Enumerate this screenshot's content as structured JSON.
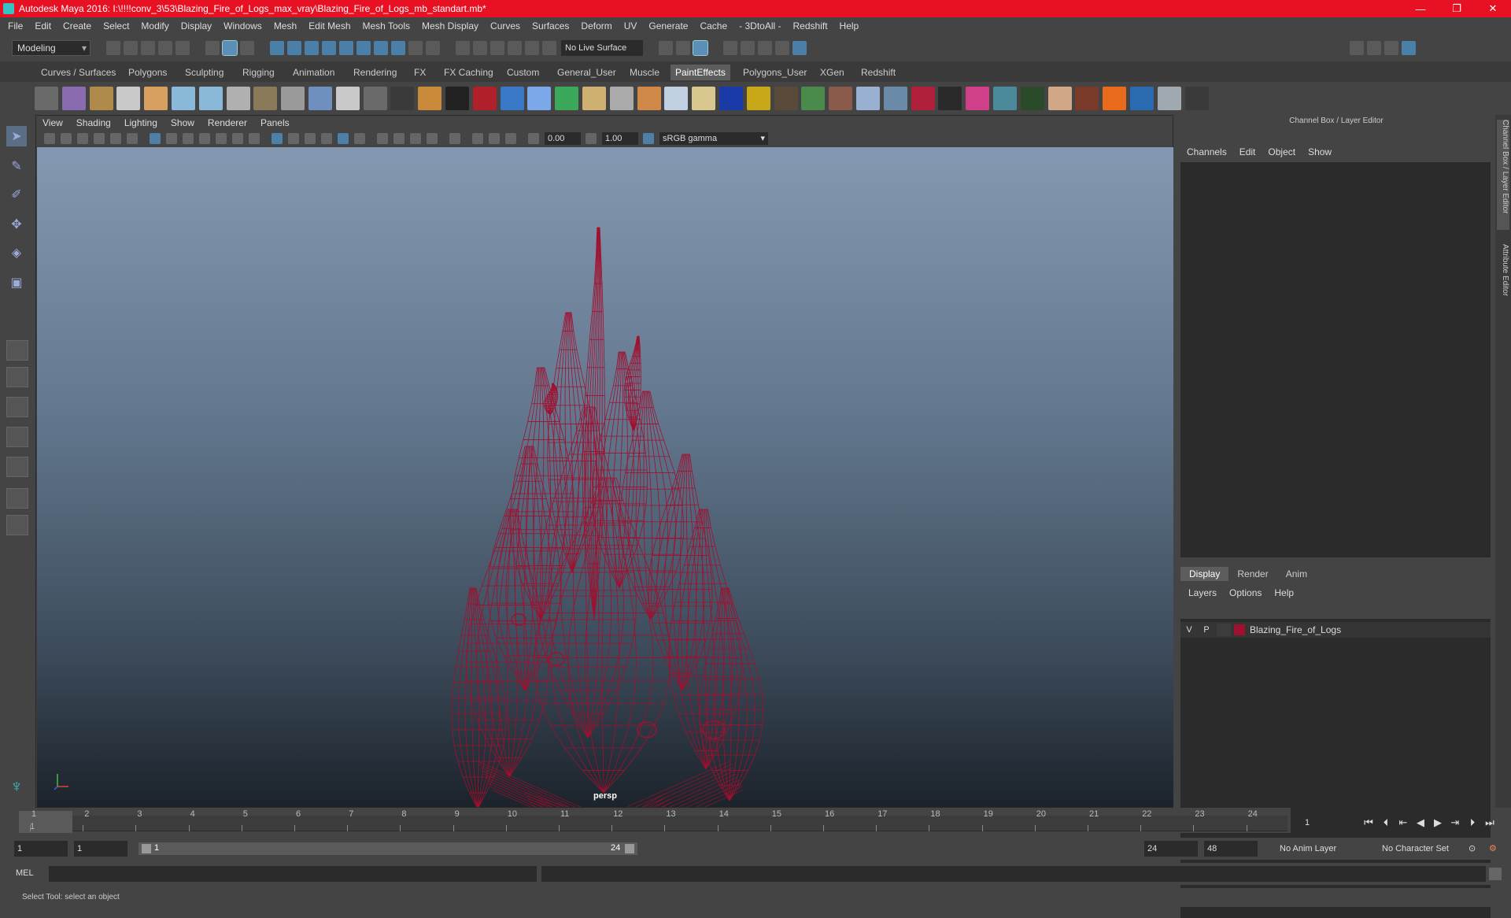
{
  "window": {
    "title": "Autodesk Maya 2016: I:\\!!!!conv_3\\53\\Blazing_Fire_of_Logs_max_vray\\Blazing_Fire_of_Logs_mb_standart.mb*",
    "minimize": "—",
    "maximize": "❐",
    "close": "✕"
  },
  "menubar": [
    "File",
    "Edit",
    "Create",
    "Select",
    "Modify",
    "Display",
    "Windows",
    "Mesh",
    "Edit Mesh",
    "Mesh Tools",
    "Mesh Display",
    "Curves",
    "Surfaces",
    "Deform",
    "UV",
    "Generate",
    "Cache",
    "- 3DtoAll -",
    "Redshift",
    "Help"
  ],
  "toolbar": {
    "mode": "Modeling",
    "live_surface": "No Live Surface"
  },
  "shelf": {
    "tabs": [
      "Curves / Surfaces",
      "Polygons",
      "Sculpting",
      "Rigging",
      "Animation",
      "Rendering",
      "FX",
      "FX Caching",
      "Custom",
      "General_User",
      "Muscle",
      "PaintEffects",
      "Polygons_User",
      "XGen",
      "Redshift"
    ],
    "active_tab": "PaintEffects",
    "icon_colors": [
      "#6a6a6a",
      "#8a6bb0",
      "#b08a4a",
      "#c9c9c9",
      "#d8a060",
      "#8ab8d8",
      "#8ab8d8",
      "#b0b0b0",
      "#8a7a5a",
      "#9a9a9a",
      "#6f8fbf",
      "#c9c9c9",
      "#6a6a6a",
      "#3a3a3a",
      "#c98a3a",
      "#222222",
      "#b0202a",
      "#3a78c8",
      "#7aa8e8",
      "#3aa858",
      "#d0b070",
      "#aaaaaa",
      "#d08848",
      "#c0d0e0",
      "#d8c890",
      "#1a3aa8",
      "#c8a818",
      "#5a4a3a",
      "#4a8a4a",
      "#8a5a4a",
      "#9ab0d0",
      "#6a8aaa",
      "#b0203a",
      "#2a2a2a",
      "#d0408a",
      "#4a8a9a",
      "#2a4a2a",
      "#d0a888",
      "#7a3a2a",
      "#e86a1a",
      "#2a6ab0",
      "#a0a8b0",
      "#3a3a3a"
    ]
  },
  "viewport": {
    "menu": [
      "View",
      "Shading",
      "Lighting",
      "Show",
      "Renderer",
      "Panels"
    ],
    "near": "0.00",
    "far": "1.00",
    "color_space": "sRGB gamma",
    "camera": "persp",
    "wire_color": "#a0102f"
  },
  "channel_box": {
    "title": "Channel Box / Layer Editor",
    "menu": [
      "Channels",
      "Edit",
      "Object",
      "Show"
    ],
    "layer_tabs": [
      "Display",
      "Render",
      "Anim"
    ],
    "active_layer_tab": "Display",
    "layer_menu": [
      "Layers",
      "Options",
      "Help"
    ],
    "layers": [
      {
        "v": "V",
        "p": "P",
        "name": "Blazing_Fire_of_Logs",
        "color": "#a0102f"
      }
    ]
  },
  "side_tabs": [
    "Channel Box / Layer Editor",
    "Attribute Editor"
  ],
  "timeline": {
    "ticks": [
      "1",
      "2",
      "3",
      "4",
      "5",
      "6",
      "7",
      "8",
      "9",
      "10",
      "11",
      "12",
      "13",
      "14",
      "15",
      "16",
      "17",
      "18",
      "19",
      "20",
      "21",
      "22",
      "23",
      "24"
    ],
    "current_frame_label": "1",
    "current_frame_field": "1"
  },
  "range": {
    "start": "1",
    "playback_start": "1",
    "slider_start": "1",
    "slider_end": "24",
    "playback_end": "24",
    "end": "48",
    "anim_layer": "No Anim Layer",
    "character_set": "No Character Set"
  },
  "command": {
    "label": "MEL"
  },
  "status": {
    "help_line": "Select Tool: select an object"
  }
}
